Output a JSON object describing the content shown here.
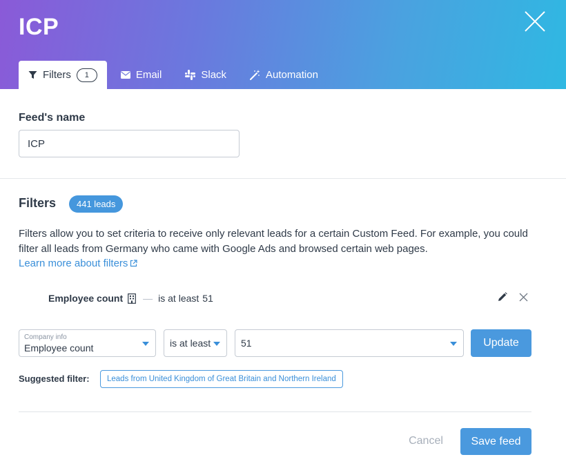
{
  "header": {
    "title": "ICP",
    "close_icon": "close-icon"
  },
  "tabs": [
    {
      "label": "Filters",
      "icon": "funnel-icon",
      "badge": "1",
      "active": true
    },
    {
      "label": "Email",
      "icon": "envelope-icon"
    },
    {
      "label": "Slack",
      "icon": "slack-icon"
    },
    {
      "label": "Automation",
      "icon": "magic-wand-icon"
    }
  ],
  "feed_name": {
    "label": "Feed's name",
    "value": "ICP"
  },
  "filters": {
    "title": "Filters",
    "leads_badge": "441 leads",
    "description": "Filters allow you to set criteria to receive only relevant leads for a certain Custom Feed. For example, you could filter all leads from Germany who came with Google Ads and browsed certain web pages.",
    "learn_more": "Learn more about filters",
    "rule": {
      "field": "Employee count",
      "field_icon": "building-icon",
      "dash": "—",
      "operator": "is at least",
      "value": "51"
    },
    "editor": {
      "field_group": "Company info",
      "field": "Employee count",
      "operator": "is at least",
      "value": "51",
      "update_label": "Update"
    },
    "suggested_label": "Suggested filter:",
    "suggested_chip": "Leads from United Kingdom of Great Britain and Northern Ireland"
  },
  "footer": {
    "cancel_label": "Cancel",
    "save_label": "Save feed"
  },
  "colors": {
    "accent": "#4a99de",
    "header_gradient_start": "#8a5ad8",
    "header_gradient_end": "#2fb8e2",
    "text": "#2f3a48"
  }
}
